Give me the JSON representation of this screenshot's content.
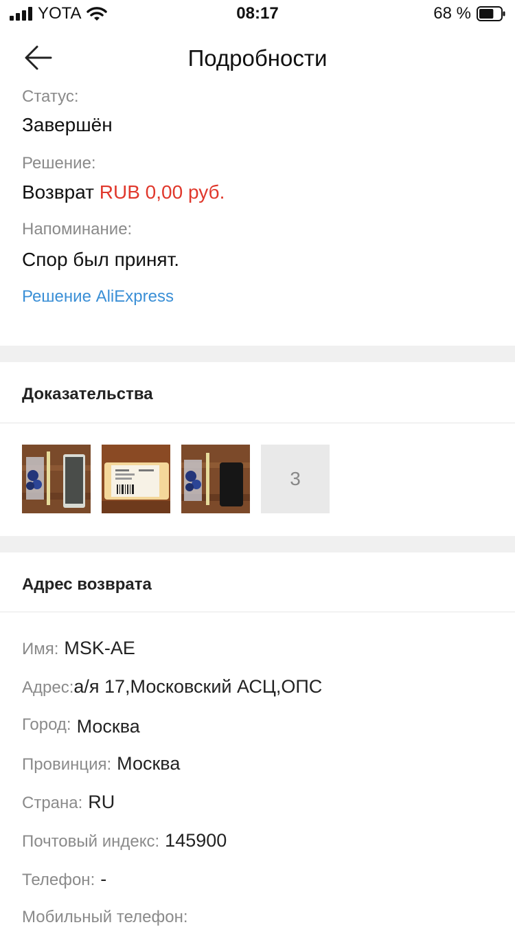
{
  "status_bar": {
    "carrier": "YOTA",
    "time": "08:17",
    "battery": "68 %",
    "battery_level": 0.68,
    "icons": [
      "signal-icon",
      "wifi-icon",
      "battery-icon"
    ]
  },
  "header": {
    "title": "Подробности",
    "back_icon": "arrow-left-icon"
  },
  "details": {
    "status_label": "Статус:",
    "status_value": "Завершён",
    "resolution_label": "Решение:",
    "resolution_text": "Возврат",
    "resolution_amount": "RUB 0,00 руб.",
    "reminder_label": "Напоминание:",
    "reminder_value": "Спор был принят.",
    "link": "Решение AliExpress"
  },
  "evidence": {
    "title": "Доказательства",
    "more_count": "3"
  },
  "return_address": {
    "title": "Адрес возврата",
    "rows": [
      {
        "label": "Имя:",
        "value": "MSK-AE"
      },
      {
        "label": "Адрес:",
        "value": "а/я 17,Московский АСЦ,ОПС"
      },
      {
        "label": "Город:",
        "value": "Москва"
      },
      {
        "label": "Провинция:",
        "value": "Москва"
      },
      {
        "label": "Страна:",
        "value": "RU"
      },
      {
        "label": "Почтовый индекс:",
        "value": "145900"
      },
      {
        "label": "Телефон:",
        "value": "-"
      },
      {
        "label": "Мобильный телефон:",
        "value": ""
      }
    ]
  },
  "colors": {
    "accent_red": "#e0382c",
    "link_blue": "#3a8fd6",
    "separator": "#f0f0f0"
  }
}
